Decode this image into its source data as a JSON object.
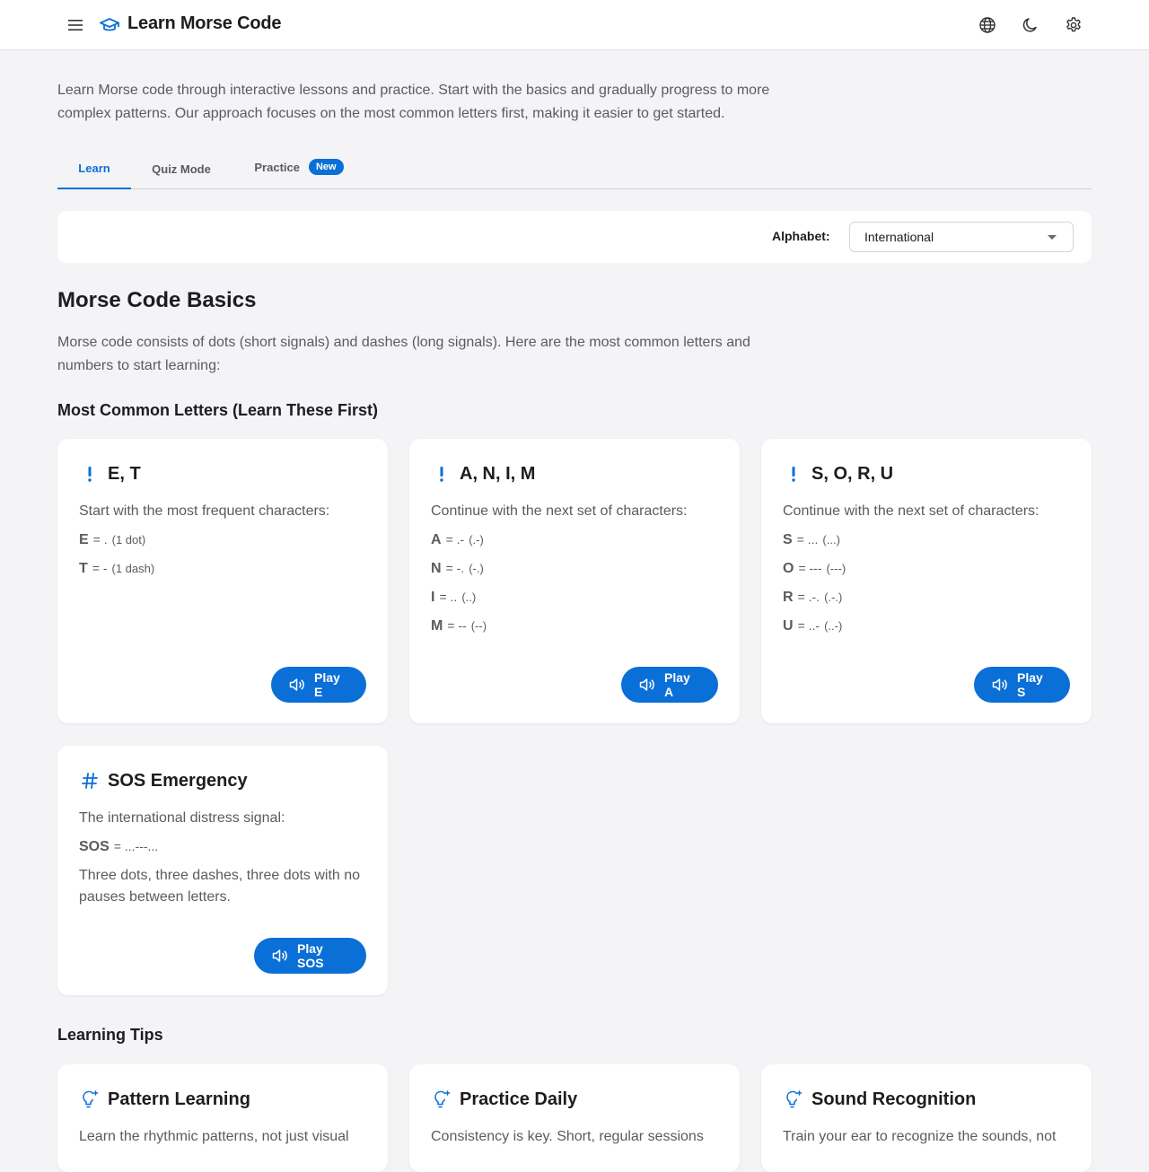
{
  "app": {
    "title": "Learn Morse Code"
  },
  "header_icons": [
    "menu-icon",
    "graduation-cap-icon",
    "globe-icon",
    "moon-icon",
    "gear-icon"
  ],
  "intro": "Learn Morse code through interactive lessons and practice. Start with the basics and gradually progress to more complex patterns. Our approach focuses on the most common letters first, making it easier to get started.",
  "tabs": [
    {
      "label": "Learn",
      "active": true
    },
    {
      "label": "Quiz Mode",
      "active": false
    },
    {
      "label": "Practice",
      "active": false,
      "badge": "New"
    }
  ],
  "filter": {
    "label": "Alphabet:",
    "value": "International"
  },
  "basics": {
    "title": "Morse Code Basics",
    "description": "Morse code consists of dots (short signals) and dashes (long signals). Here are the most common letters and numbers to start learning:",
    "common_heading": "Most Common Letters (Learn These First)"
  },
  "cards": [
    {
      "icon": "exclamation-icon",
      "title": "E, T",
      "description": "Start with the most frequent characters:",
      "codes": [
        {
          "char": "E",
          "code": "= .",
          "note": "(1 dot)"
        },
        {
          "char": "T",
          "code": "= -",
          "note": "(1 dash)"
        }
      ],
      "button": "Play E"
    },
    {
      "icon": "exclamation-icon",
      "title": "A, N, I, M",
      "description": "Continue with the next set of characters:",
      "codes": [
        {
          "char": "A",
          "code": "= .-",
          "note": "(.-)"
        },
        {
          "char": "N",
          "code": "= -.",
          "note": "(-.)"
        },
        {
          "char": "I",
          "code": "= ..",
          "note": "(..)"
        },
        {
          "char": "M",
          "code": "= --",
          "note": "(--)"
        }
      ],
      "button": "Play A"
    },
    {
      "icon": "exclamation-icon",
      "title": "S, O, R, U",
      "description": "Continue with the next set of characters:",
      "codes": [
        {
          "char": "S",
          "code": "= ...",
          "note": "(...)"
        },
        {
          "char": "O",
          "code": "= ---",
          "note": "(---)"
        },
        {
          "char": "R",
          "code": "= .-.",
          "note": "(.-.)"
        },
        {
          "char": "U",
          "code": "= ..-",
          "note": "(..-)"
        }
      ],
      "button": "Play S"
    },
    {
      "icon": "hash-icon",
      "title": "SOS Emergency",
      "description": "The international distress signal:",
      "codes": [
        {
          "char": "SOS",
          "code": "= ...---...",
          "note": ""
        }
      ],
      "note": "Three dots, three dashes, three dots with no pauses between letters.",
      "button": "Play SOS"
    }
  ],
  "tips": {
    "heading": "Learning Tips",
    "items": [
      {
        "icon": "lightbulb-icon",
        "title": "Pattern Learning",
        "description": "Learn the rhythmic patterns, not just visual"
      },
      {
        "icon": "lightbulb-icon",
        "title": "Practice Daily",
        "description": "Consistency is key. Short, regular sessions"
      },
      {
        "icon": "lightbulb-icon",
        "title": "Sound Recognition",
        "description": "Train your ear to recognize the sounds, not"
      }
    ]
  },
  "colors": {
    "accent": "#0a6fd6",
    "background": "#f4f4f6",
    "text_muted": "#5b5b60"
  }
}
